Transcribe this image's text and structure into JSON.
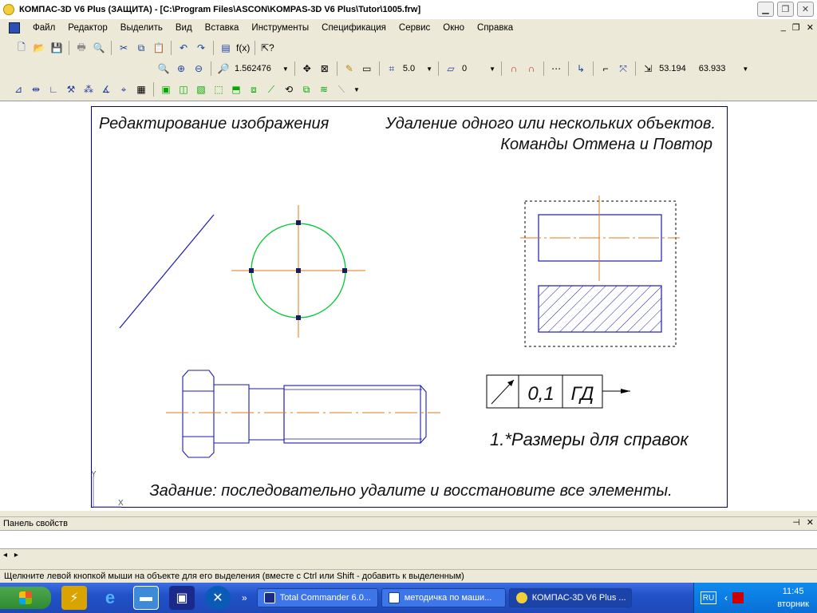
{
  "window": {
    "title": "КОМПАС-3D V6 Plus (ЗАЩИТА) - [C:\\Program Files\\ASCON\\KOMPAS-3D V6 Plus\\Tutor\\1005.frw]"
  },
  "menu": [
    "Файл",
    "Редактор",
    "Выделить",
    "Вид",
    "Вставка",
    "Инструменты",
    "Спецификация",
    "Сервис",
    "Окно",
    "Справка"
  ],
  "toolbar": {
    "zoom_value": "1.562476",
    "step_value": "5.0",
    "layer_value": "0",
    "coord_x": "53.194",
    "coord_y": "63.933",
    "fx_label": "f(x)"
  },
  "drawing": {
    "title_left": "Редактирование изображения",
    "title_right_1": "Удаление одного или нескольких объектов.",
    "title_right_2": "Команды Отмена и Повтор",
    "tolerance_value": "0,1",
    "tolerance_base": "ГД",
    "note": "1.*Размеры для справок",
    "task": "Задание: последовательно удалите и восстановите все элементы.",
    "axis_x": "X",
    "axis_y": "Y",
    "colors": {
      "frame": "#00008b",
      "axis": "#e07a14",
      "circle": "#00c832",
      "line": "#1a1ab0"
    }
  },
  "properties_panel": {
    "title": "Панель свойств"
  },
  "status": {
    "text": "Щелкните левой кнопкой мыши на объекте для его выделения (вместе с Ctrl или Shift - добавить к выделенным)"
  },
  "taskbar": {
    "overflow": "»",
    "tasks": [
      {
        "label": "Total Commander 6.0...",
        "icon": "floppy-icon",
        "active": false
      },
      {
        "label": "методичка по маши...",
        "icon": "word-icon",
        "active": false
      },
      {
        "label": "КОМПАС-3D V6 Plus ...",
        "icon": "kompas-icon",
        "active": true
      }
    ],
    "language": "RU",
    "time": "11:45",
    "day": "вторник"
  }
}
